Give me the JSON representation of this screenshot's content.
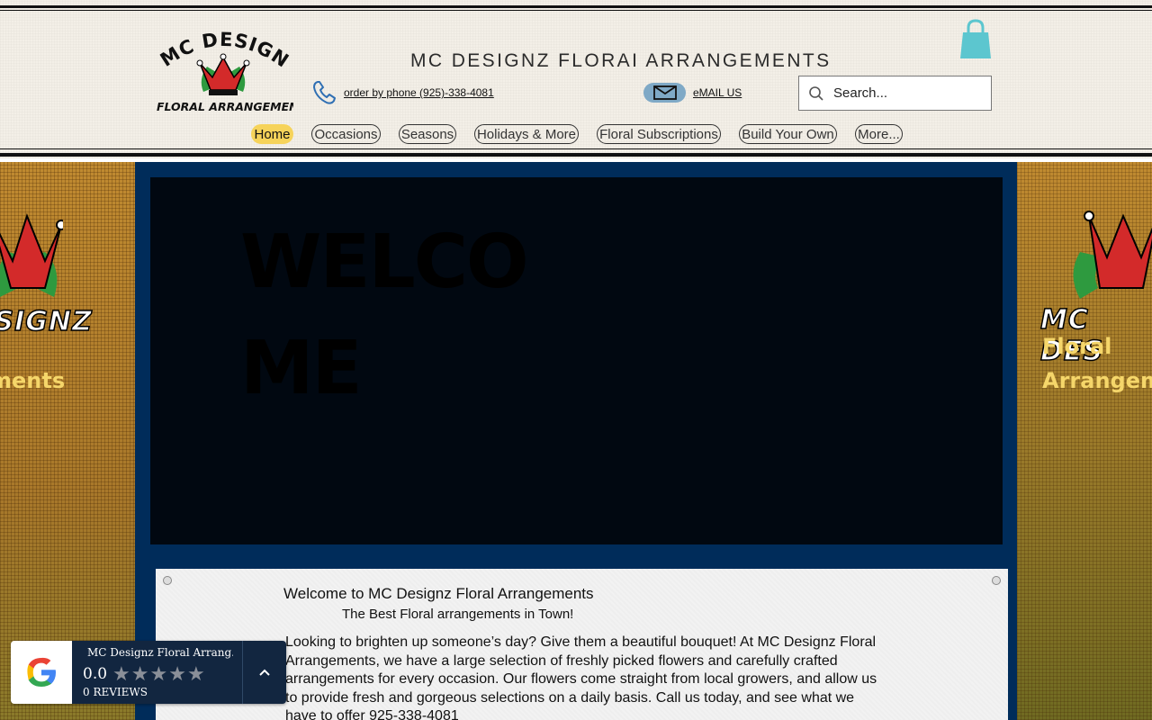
{
  "header": {
    "logo_text": "MC DESIGNZ",
    "logo_subtext": "FLORAL ARRANGEMENTS",
    "site_title": "MC DESIGNZ FLORAI ARRANGEMENTS",
    "phone_link": "order by phone (925)-338-4081",
    "email_link": "eMAIL US",
    "search_placeholder": "Search...",
    "cart_icon": "shopping-bag-icon"
  },
  "nav": {
    "items": [
      {
        "label": "Home",
        "active": true
      },
      {
        "label": "Occasions"
      },
      {
        "label": "Seasons"
      },
      {
        "label": "Holidays & More"
      },
      {
        "label": "Floral Subscriptions"
      },
      {
        "label": "Build Your Own"
      },
      {
        "label": "More..."
      }
    ]
  },
  "side": {
    "left_text": "ments",
    "left_brand": "ESIGNZ",
    "right_text_1": "Floral",
    "right_text_2": "Arrangem",
    "right_brand": "MC DES"
  },
  "hero": {
    "welcome": "WELCOME"
  },
  "card": {
    "title": "Welcome to MC Designz Floral Arrangements",
    "subtitle": "The Best Floral arrangements in Town!",
    "body": "Looking to brighten up someone’s day? Give them a beautiful bouquet! At MC Designz Floral Arrangements, we have a large selection of freshly picked flowers and carefully crafted arrangements for every occasion. Our flowers come straight from local growers, and allow us to provide fresh and gorgeous selections on a daily basis. Call us today, and see what we have to offer 925-338-4081"
  },
  "review_widget": {
    "business_name": "MC Designz Floral Arrang...",
    "score": "0.0",
    "stars": 0,
    "reviews": "0 REVIEWS"
  },
  "colors": {
    "nav_active": "#f6d35a",
    "main_bg": "#002c5a",
    "cart": "#5cc6cf",
    "widget_bg": "#122640"
  }
}
